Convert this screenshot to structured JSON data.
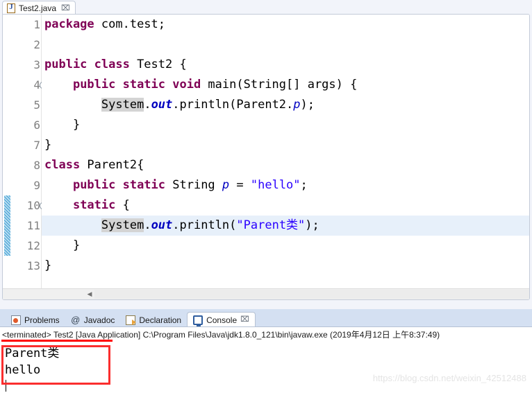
{
  "editor": {
    "tab": {
      "label": "Test2.java",
      "icon": "java-file-icon",
      "close": "⌧"
    },
    "lines": [
      {
        "num": "1",
        "fold": false,
        "changed": false,
        "current": false,
        "tokens": [
          {
            "t": "package",
            "c": "kw"
          },
          {
            "t": " com.test;",
            "c": ""
          }
        ]
      },
      {
        "num": "2",
        "fold": false,
        "changed": false,
        "current": false,
        "tokens": [
          {
            "t": "",
            "c": ""
          }
        ]
      },
      {
        "num": "3",
        "fold": false,
        "changed": false,
        "current": false,
        "tokens": [
          {
            "t": "public class",
            "c": "kw"
          },
          {
            "t": " Test2 {",
            "c": ""
          }
        ]
      },
      {
        "num": "4",
        "fold": true,
        "changed": false,
        "current": false,
        "tokens": [
          {
            "t": "    ",
            "c": ""
          },
          {
            "t": "public static void",
            "c": "kw"
          },
          {
            "t": " main(String[] args) {",
            "c": ""
          }
        ]
      },
      {
        "num": "5",
        "fold": false,
        "changed": false,
        "current": false,
        "tokens": [
          {
            "t": "        ",
            "c": ""
          },
          {
            "t": "System",
            "c": "occ"
          },
          {
            "t": ".",
            "c": ""
          },
          {
            "t": "out",
            "c": "sfld"
          },
          {
            "t": ".println(Parent2.",
            "c": ""
          },
          {
            "t": "p",
            "c": "fld"
          },
          {
            "t": ");",
            "c": ""
          }
        ]
      },
      {
        "num": "6",
        "fold": false,
        "changed": false,
        "current": false,
        "tokens": [
          {
            "t": "    }",
            "c": ""
          }
        ]
      },
      {
        "num": "7",
        "fold": false,
        "changed": false,
        "current": false,
        "tokens": [
          {
            "t": "}",
            "c": ""
          }
        ]
      },
      {
        "num": "8",
        "fold": false,
        "changed": false,
        "current": false,
        "tokens": [
          {
            "t": "class",
            "c": "kw"
          },
          {
            "t": " Parent2{",
            "c": ""
          }
        ]
      },
      {
        "num": "9",
        "fold": false,
        "changed": false,
        "current": false,
        "tokens": [
          {
            "t": "    ",
            "c": ""
          },
          {
            "t": "public static",
            "c": "kw"
          },
          {
            "t": " String ",
            "c": ""
          },
          {
            "t": "p",
            "c": "fld"
          },
          {
            "t": " = ",
            "c": ""
          },
          {
            "t": "\"hello\"",
            "c": "str"
          },
          {
            "t": ";",
            "c": ""
          }
        ]
      },
      {
        "num": "10",
        "fold": true,
        "changed": true,
        "current": false,
        "tokens": [
          {
            "t": "    ",
            "c": ""
          },
          {
            "t": "static",
            "c": "kw"
          },
          {
            "t": " {",
            "c": ""
          }
        ]
      },
      {
        "num": "11",
        "fold": false,
        "changed": true,
        "current": true,
        "tokens": [
          {
            "t": "        ",
            "c": ""
          },
          {
            "t": "System",
            "c": "occ"
          },
          {
            "t": ".",
            "c": ""
          },
          {
            "t": "out",
            "c": "sfld"
          },
          {
            "t": ".println(",
            "c": ""
          },
          {
            "t": "\"Parent类\"",
            "c": "str"
          },
          {
            "t": ");",
            "c": ""
          }
        ]
      },
      {
        "num": "12",
        "fold": false,
        "changed": true,
        "current": false,
        "tokens": [
          {
            "t": "    }",
            "c": ""
          }
        ]
      },
      {
        "num": "13",
        "fold": false,
        "changed": false,
        "current": false,
        "tokens": [
          {
            "t": "}",
            "c": ""
          }
        ]
      }
    ],
    "scrollbar": {
      "left_arrow": "◀"
    }
  },
  "console_part": {
    "tabs": [
      {
        "label": "Problems",
        "icon": "problems-icon",
        "active": false,
        "close": ""
      },
      {
        "label": "Javadoc",
        "icon": "javadoc-icon",
        "active": false,
        "close": ""
      },
      {
        "label": "Declaration",
        "icon": "declaration-icon",
        "active": false,
        "close": ""
      },
      {
        "label": "Console",
        "icon": "console-icon",
        "active": true,
        "close": "⌧"
      }
    ],
    "status_line": "<terminated> Test2 [Java Application] C:\\Program Files\\Java\\jdk1.8.0_121\\bin\\javaw.exe (2019年4月12日 上午8:37:49)",
    "output_lines": [
      "Parent类",
      "hello"
    ]
  },
  "watermark": "https://blog.csdn.net/weixin_42512488",
  "colors": {
    "keyword": "#7f0055",
    "string": "#2a00ff",
    "field": "#0000c0",
    "current_line": "#e7f0fa",
    "occurrence": "#d4d4d4",
    "annotation_red": "#fb2e2e",
    "change_bar": "#3f9fd4"
  }
}
